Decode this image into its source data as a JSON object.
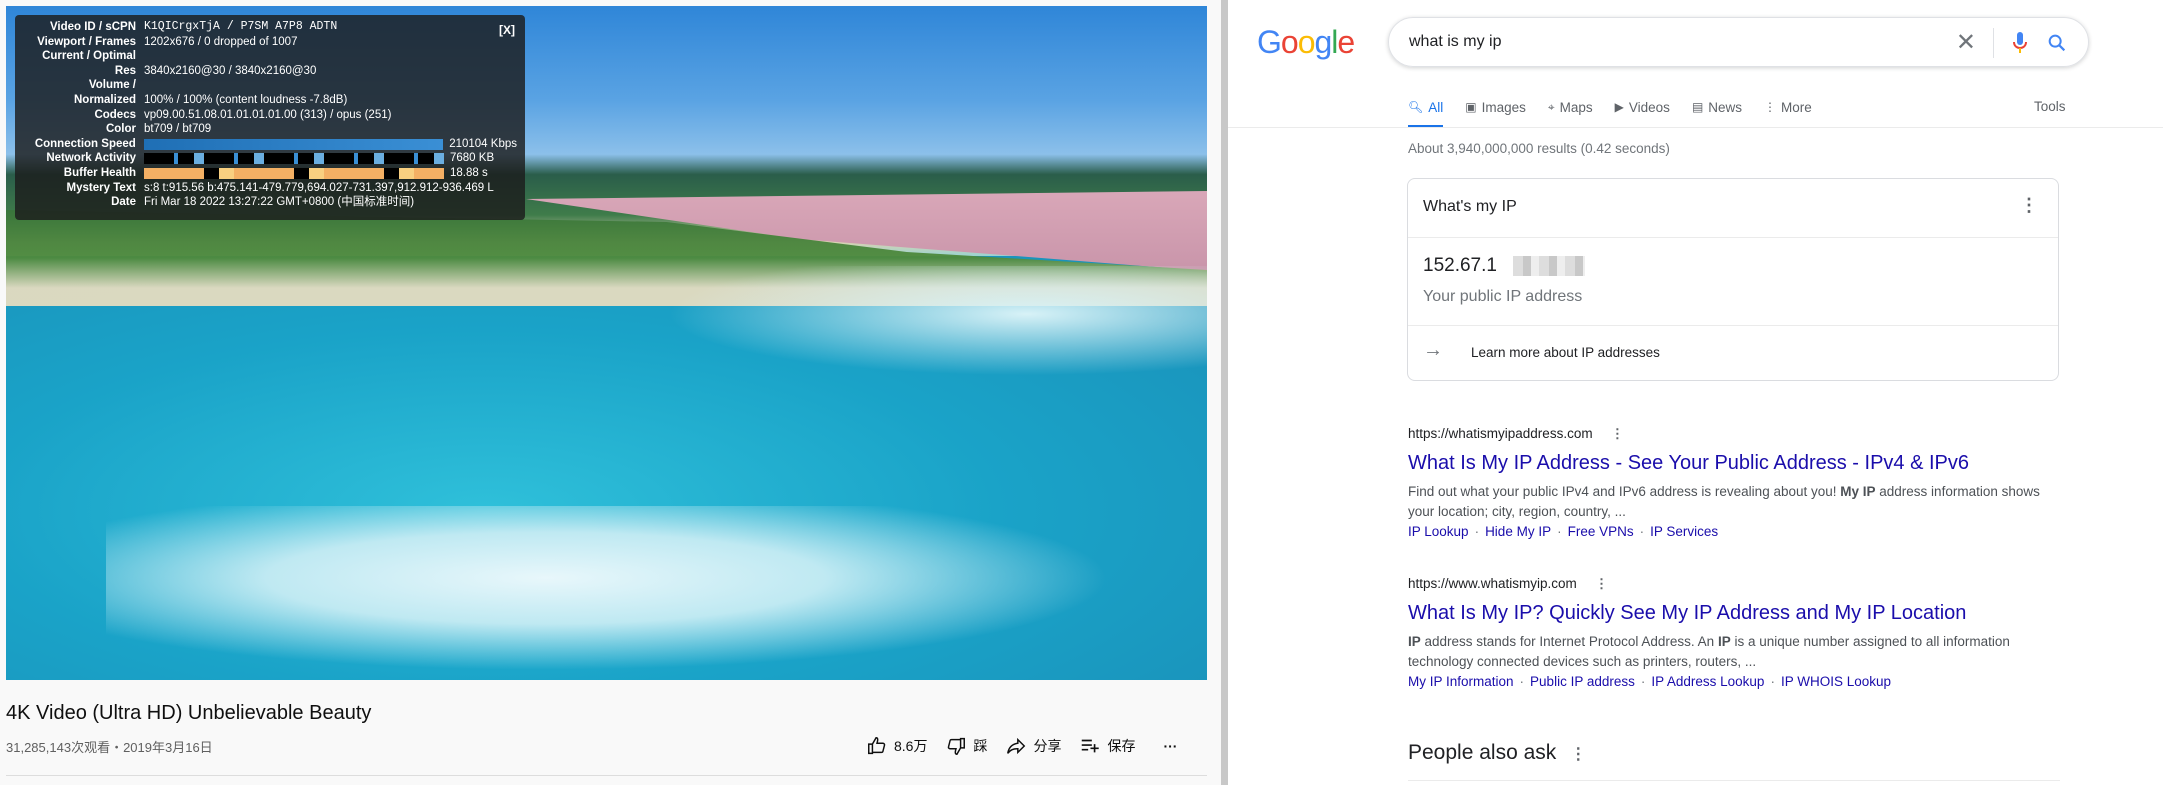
{
  "video": {
    "stats": [
      {
        "k": "Video ID / sCPN",
        "v": "K1QICrgxTjA / P7SM A7P8 ADTN",
        "mono": true
      },
      {
        "k": "Viewport / Frames",
        "v": "1202x676 / 0 dropped of 1007"
      },
      {
        "k": "Current / Optimal",
        "v": ""
      },
      {
        "k": "Res",
        "v": "3840x2160@30 / 3840x2160@30"
      },
      {
        "k": "Volume /",
        "v": ""
      },
      {
        "k": "Normalized",
        "v": "100% / 100% (content loudness -7.8dB)"
      },
      {
        "k": "Codecs",
        "v": "vp09.00.51.08.01.01.01.01.00 (313) / opus (251)"
      },
      {
        "k": "Color",
        "v": "bt709 / bt709"
      },
      {
        "k": "Connection Speed",
        "v": "210104 Kbps",
        "bar": "b1"
      },
      {
        "k": "Network Activity",
        "v": "7680 KB",
        "bar": "b2"
      },
      {
        "k": "Buffer Health",
        "v": "18.88 s",
        "bar": "b3"
      },
      {
        "k": "Mystery Text",
        "v": "s:8 t:915.56 b:475.141-479.779,694.027-731.397,912.912-936.469 L"
      },
      {
        "k": "Date",
        "v": "Fri Mar 18 2022 13:27:22 GMT+0800 (中国标准时间)"
      }
    ],
    "close_label": "[X]",
    "title": "4K Video (Ultra HD) Unbelievable Beauty",
    "meta": "31,285,143次观看・2019年3月16日",
    "actions": {
      "like": "8.6万",
      "dislike": "踩",
      "share": "分享",
      "save": "保存",
      "more": "···"
    }
  },
  "google": {
    "logo": "Google",
    "logo_colors": [
      "#4285f4",
      "#ea4335",
      "#fbbc05",
      "#4285f4",
      "#34a853",
      "#ea4335"
    ],
    "query": "what is my ip",
    "tabs": [
      {
        "label": "All",
        "icon": "search-icon",
        "active": true
      },
      {
        "label": "Images",
        "icon": "image-icon"
      },
      {
        "label": "Maps",
        "icon": "map-pin-icon"
      },
      {
        "label": "Videos",
        "icon": "video-icon"
      },
      {
        "label": "News",
        "icon": "news-icon"
      },
      {
        "label": "More",
        "icon": "more-vert-icon"
      }
    ],
    "tools": "Tools",
    "result_count": "About 3,940,000,000 results (0.42 seconds)",
    "card": {
      "heading": "What's my IP",
      "ip": "152.67.1",
      "ip_label": "Your public IP address",
      "learn_more": "Learn more about IP addresses"
    },
    "results": [
      {
        "url": "https://whatismyipaddress.com",
        "title": "What Is My IP Address - See Your Public Address - IPv4 & IPv6",
        "snippet_html": "Find out what your public IPv4 and IPv6 address is revealing about you! <b>My IP</b> address information shows your location; city, region, country, ...",
        "links": [
          "IP Lookup",
          "Hide My IP",
          "Free VPNs",
          "IP Services"
        ]
      },
      {
        "url": "https://www.whatismyip.com",
        "title": "What Is My IP? Quickly See My IP Address and My IP Location",
        "snippet_html": "<b>IP</b> address stands for Internet Protocol Address. An <b>IP</b> is a unique number assigned to all information technology connected devices such as printers, routers, ...",
        "links": [
          "My IP Information",
          "Public IP address",
          "IP Address Lookup",
          "IP WHOIS Lookup"
        ]
      }
    ],
    "paa": "People also ask",
    "accent": "#1a73e8",
    "link_color": "#1a0dab"
  }
}
